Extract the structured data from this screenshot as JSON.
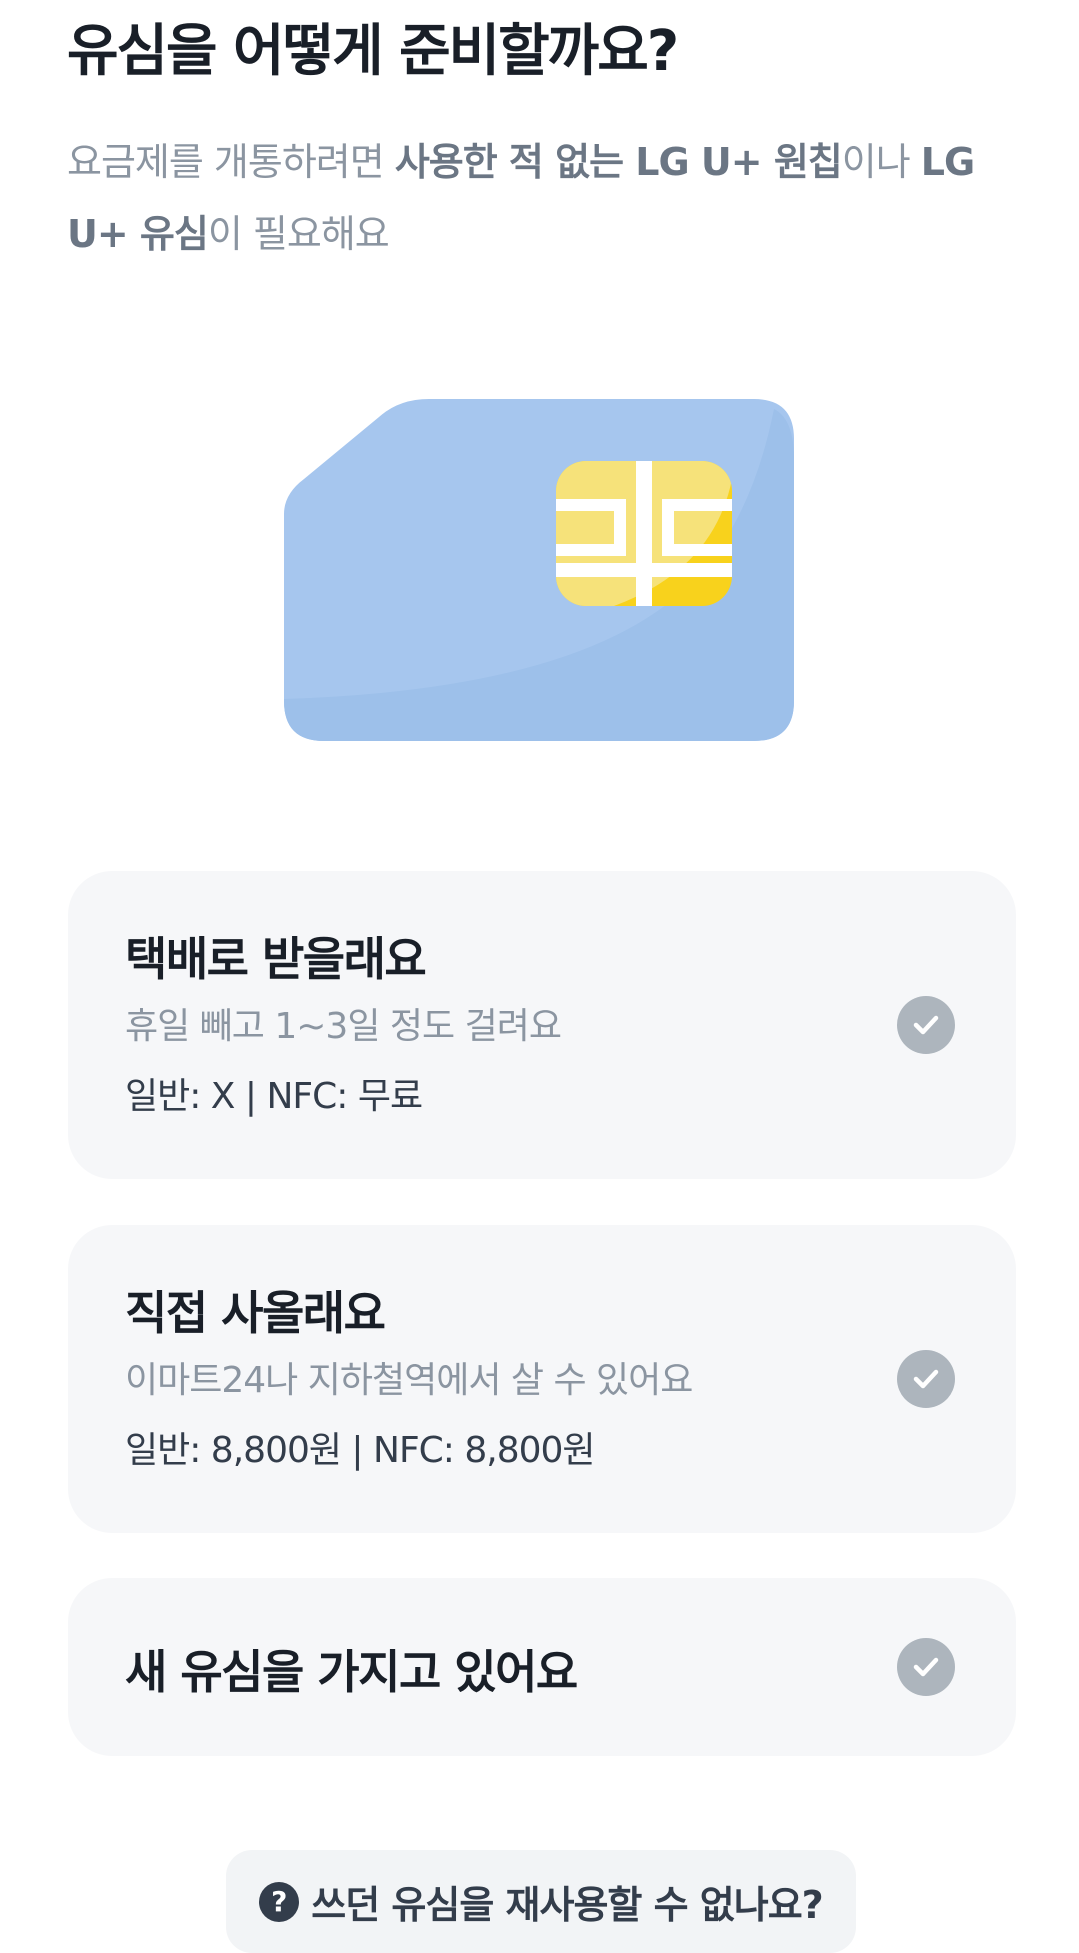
{
  "header": {
    "title": "유심을 어떻게 준비할까요?",
    "subtitle_part1": "요금제를 개통하려면 ",
    "subtitle_bold1": "사용한 적 없는 LG U+ 원칩",
    "subtitle_part2": "이나 ",
    "subtitle_bold2": "LG U+ 유심",
    "subtitle_part3": "이 필요해요"
  },
  "illustration": {
    "icon": "sim-card-icon",
    "card_color": "#a6c6ee",
    "chip_color": "#f8d21c"
  },
  "options": [
    {
      "title": "택배로 받을래요",
      "description": "휴일 빼고 1~3일 정도 걸려요",
      "price": "일반: X | NFC: 무료",
      "icon": "check-icon"
    },
    {
      "title": "직접 사올래요",
      "description": "이마트24나 지하철역에서 살 수 있어요",
      "price": "일반: 8,800원 | NFC: 8,800원",
      "icon": "check-icon"
    },
    {
      "title": "새 유심을 가지고 있어요",
      "icon": "check-icon"
    }
  ],
  "help": {
    "icon_glyph": "?",
    "label": "쓰던 유심을 재사용할 수 없나요?"
  },
  "colors": {
    "card_background": "#f6f7f9",
    "check_circle": "#adb5bd",
    "title_text": "#191f28",
    "sub_text": "#8b95a1"
  }
}
